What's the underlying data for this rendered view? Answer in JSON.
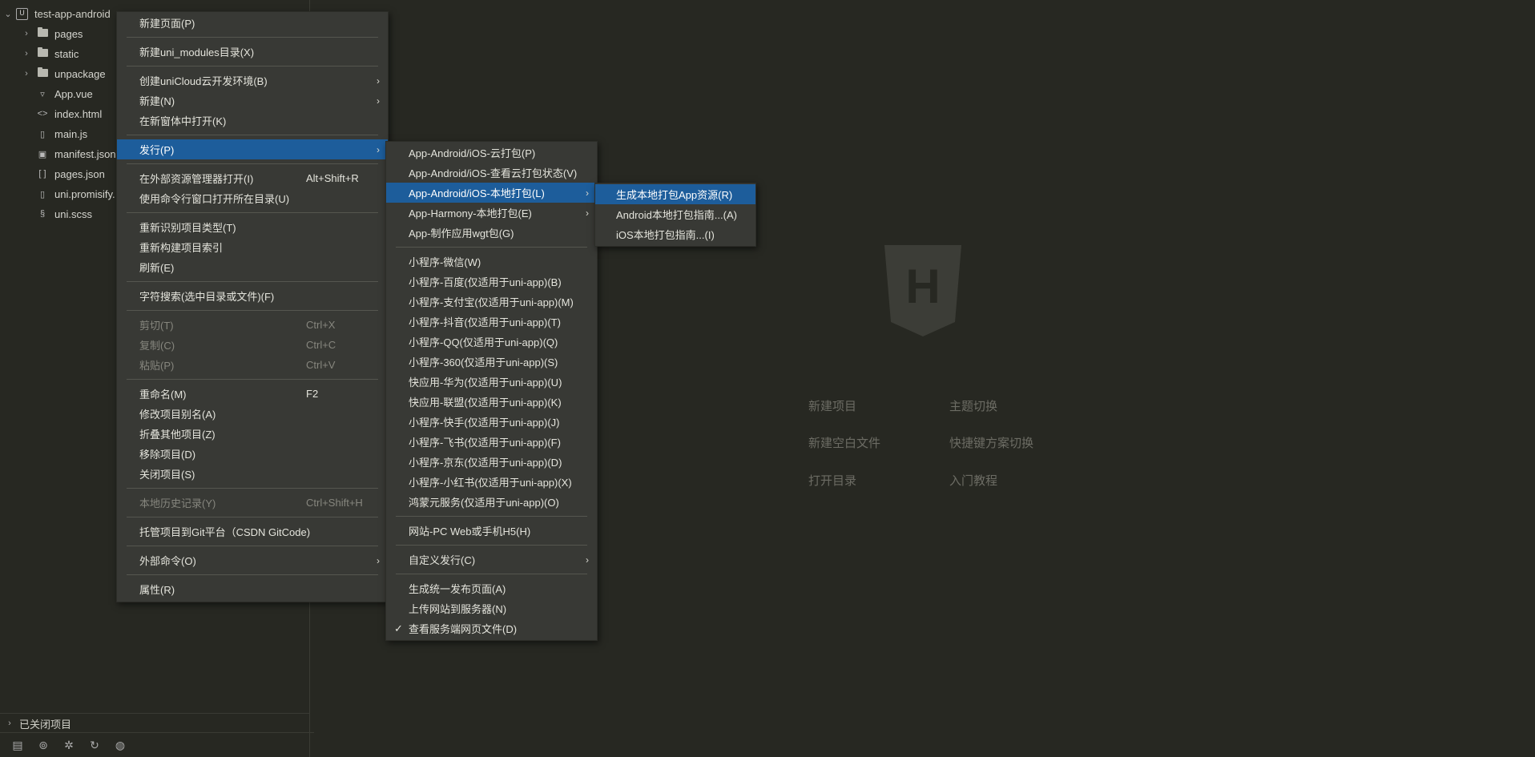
{
  "sidebar": {
    "project_name": "test-app-android",
    "root_icon_letter": "U",
    "items": [
      {
        "label": "pages",
        "type": "folder"
      },
      {
        "label": "static",
        "type": "folder"
      },
      {
        "label": "unpackage",
        "type": "folder"
      },
      {
        "label": "App.vue",
        "type": "vue"
      },
      {
        "label": "index.html",
        "type": "html"
      },
      {
        "label": "main.js",
        "type": "js"
      },
      {
        "label": "manifest.json",
        "type": "manifest"
      },
      {
        "label": "pages.json",
        "type": "json"
      },
      {
        "label": "uni.promisify.",
        "type": "js"
      },
      {
        "label": "uni.scss",
        "type": "scss"
      }
    ],
    "closed_projects_label": "已关闭项目"
  },
  "welcome": {
    "logo_letter": "H",
    "links": {
      "new_project": "新建项目",
      "theme_switch": "主题切换",
      "new_blank_file": "新建空白文件",
      "keymap_switch": "快捷键方案切换",
      "open_directory": "打开目录",
      "getting_started": "入门教程"
    }
  },
  "context_menu": {
    "new_page": "新建页面(P)",
    "new_uni_modules": "新建uni_modules目录(X)",
    "create_unicloud": "创建uniCloud云开发环境(B)",
    "new": "新建(N)",
    "open_in_new_window": "在新窗体中打开(K)",
    "publish": "发行(P)",
    "open_in_explorer": "在外部资源管理器打开(I)",
    "open_in_explorer_shortcut": "Alt+Shift+R",
    "open_in_terminal": "使用命令行窗口打开所在目录(U)",
    "reidentify_type": "重新识别项目类型(T)",
    "rebuild_index": "重新构建项目索引",
    "refresh": "刷新(E)",
    "text_search": "字符搜索(选中目录或文件)(F)",
    "cut": "剪切(T)",
    "cut_shortcut": "Ctrl+X",
    "copy": "复制(C)",
    "copy_shortcut": "Ctrl+C",
    "paste": "粘贴(P)",
    "paste_shortcut": "Ctrl+V",
    "rename": "重命名(M)",
    "rename_shortcut": "F2",
    "edit_alias": "修改项目别名(A)",
    "collapse_others": "折叠其他项目(Z)",
    "remove_project": "移除项目(D)",
    "close_project": "关闭项目(S)",
    "local_history": "本地历史记录(Y)",
    "local_history_shortcut": "Ctrl+Shift+H",
    "host_on_git": "托管项目到Git平台（CSDN GitCode)",
    "external_commands": "外部命令(O)",
    "properties": "属性(R)"
  },
  "publish_menu": {
    "cloud_pack": "App-Android/iOS-云打包(P)",
    "cloud_status": "App-Android/iOS-查看云打包状态(V)",
    "local_pack": "App-Android/iOS-本地打包(L)",
    "harmony_pack": "App-Harmony-本地打包(E)",
    "wgt_pack": "App-制作应用wgt包(G)",
    "mp_weixin": "小程序-微信(W)",
    "mp_baidu": "小程序-百度(仅适用于uni-app)(B)",
    "mp_alipay": "小程序-支付宝(仅适用于uni-app)(M)",
    "mp_douyin": "小程序-抖音(仅适用于uni-app)(T)",
    "mp_qq": "小程序-QQ(仅适用于uni-app)(Q)",
    "mp_360": "小程序-360(仅适用于uni-app)(S)",
    "qa_huawei": "快应用-华为(仅适用于uni-app)(U)",
    "qa_union": "快应用-联盟(仅适用于uni-app)(K)",
    "mp_kuaishou": "小程序-快手(仅适用于uni-app)(J)",
    "mp_feishu": "小程序-飞书(仅适用于uni-app)(F)",
    "mp_jd": "小程序-京东(仅适用于uni-app)(D)",
    "mp_xhs": "小程序-小红书(仅适用于uni-app)(X)",
    "harmony_meta": "鸿蒙元服务(仅适用于uni-app)(O)",
    "web_h5": "网站-PC Web或手机H5(H)",
    "custom_publish": "自定义发行(C)",
    "gen_publish_page": "生成统一发布页面(A)",
    "upload_to_server": "上传网站到服务器(N)",
    "view_server_files": "查看服务端网页文件(D)"
  },
  "local_pack_menu": {
    "gen_resources": "生成本地打包App资源(R)",
    "android_guide": "Android本地打包指南...(A)",
    "ios_guide": "iOS本地打包指南...(I)"
  },
  "colors": {
    "background": "#272822",
    "menu_bg": "#383935",
    "highlight": "#1d5d9b",
    "disabled_text": "#86867e"
  }
}
